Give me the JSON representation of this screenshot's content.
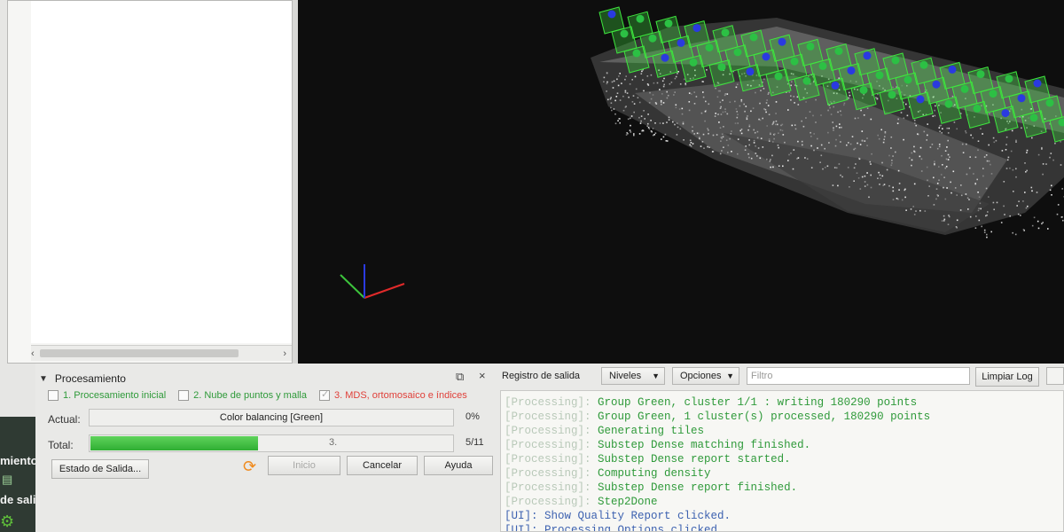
{
  "left_strip": {
    "label_1": "miento",
    "label_2": "de salida"
  },
  "processing": {
    "title": "Procesamiento",
    "steps": [
      {
        "label": "1. Procesamiento inicial",
        "color": "#2f9a3a",
        "checked": false
      },
      {
        "label": "2. Nube de puntos y malla",
        "color": "#2f9a3a",
        "checked": false
      },
      {
        "label": "3. MDS, ortomosaico e índices",
        "color": "#e0403a",
        "checked": true
      }
    ],
    "actual_label": "Actual:",
    "actual_task": "Color balancing [Green]",
    "actual_percent": "0%",
    "total_label": "Total:",
    "total_step": "3.",
    "total_count": "5/11",
    "total_progress": 0.46,
    "buttons": {
      "estado": "Estado de Salida...",
      "inicio": "Inicio",
      "cancelar": "Cancelar",
      "ayuda": "Ayuda"
    }
  },
  "log": {
    "title": "Registro de salida",
    "niveles": "Niveles",
    "opciones": "Opciones",
    "filter_placeholder": "Filtro",
    "clear_button": "Limpiar Log",
    "lines": [
      {
        "prefix": "[Processing]:",
        "msg": "Group Green, cluster 1/1 : writing 180290 points",
        "kind": "processing"
      },
      {
        "prefix": "[Processing]:",
        "msg": "Group Green, 1 cluster(s) processed, 180290 points",
        "kind": "processing"
      },
      {
        "prefix": "[Processing]:",
        "msg": "Generating tiles",
        "kind": "processing"
      },
      {
        "prefix": "[Processing]:",
        "msg": "Substep Dense matching finished.",
        "kind": "processing"
      },
      {
        "prefix": "[Processing]:",
        "msg": "Substep Dense report started.",
        "kind": "processing"
      },
      {
        "prefix": "[Processing]:",
        "msg": "Computing density",
        "kind": "processing"
      },
      {
        "prefix": "[Processing]:",
        "msg": "Substep Dense report finished.",
        "kind": "processing"
      },
      {
        "prefix": "[Processing]:",
        "msg": "Step2Done",
        "kind": "processing"
      },
      {
        "prefix": "[UI]:",
        "msg": "Show Quality Report clicked.",
        "kind": "ui"
      },
      {
        "prefix": "[UI]:",
        "msg": "Processing Options clicked.",
        "kind": "ui"
      }
    ]
  },
  "viewport": {
    "background": "#0e0e0e",
    "axis_colors": {
      "x": "#e02a2a",
      "y": "#3cc43c",
      "z": "#2a3ae0"
    }
  }
}
